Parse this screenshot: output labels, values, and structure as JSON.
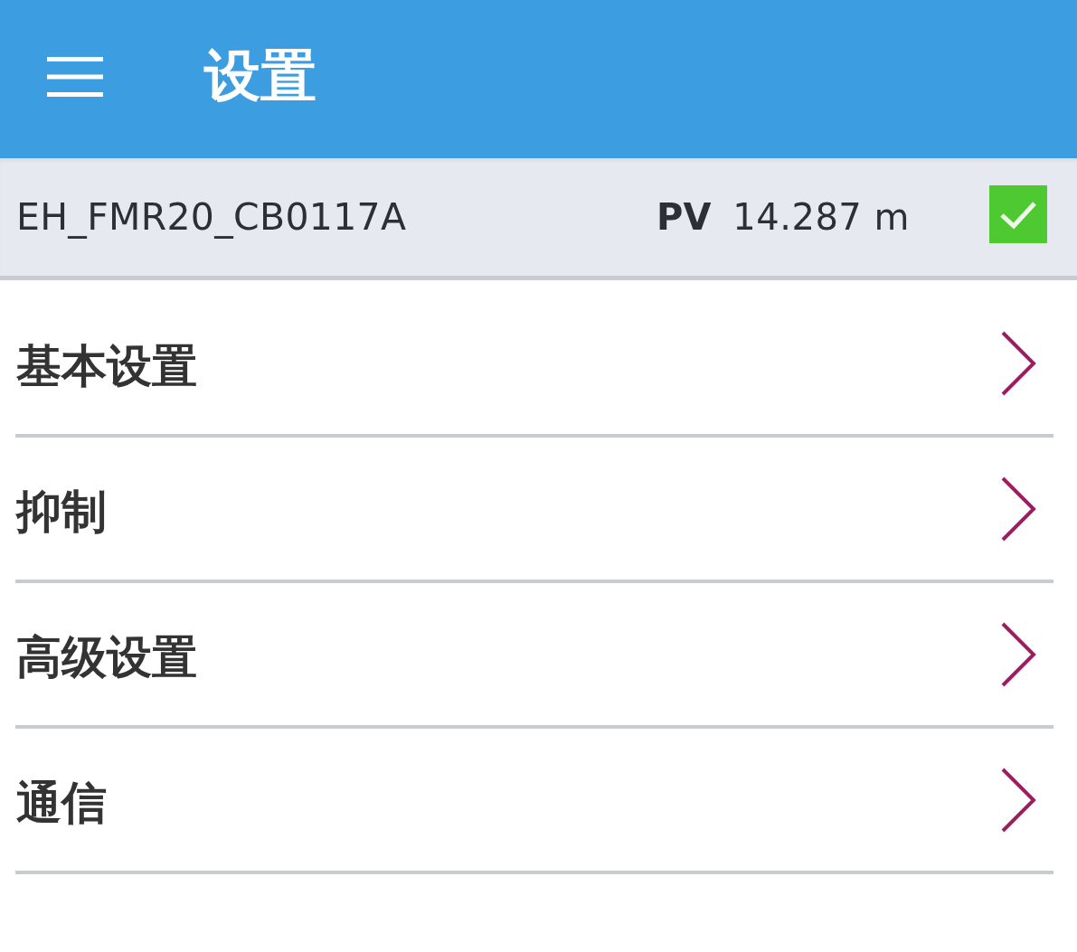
{
  "app_bar": {
    "title": "设置"
  },
  "device": {
    "name": "EH_FMR20_CB0117A",
    "pv_label": "PV",
    "pv_value": "14.287 m",
    "ok": true
  },
  "menu": [
    {
      "label": "基本设置"
    },
    {
      "label": "抑制"
    },
    {
      "label": "高级设置"
    },
    {
      "label": "通信"
    }
  ]
}
